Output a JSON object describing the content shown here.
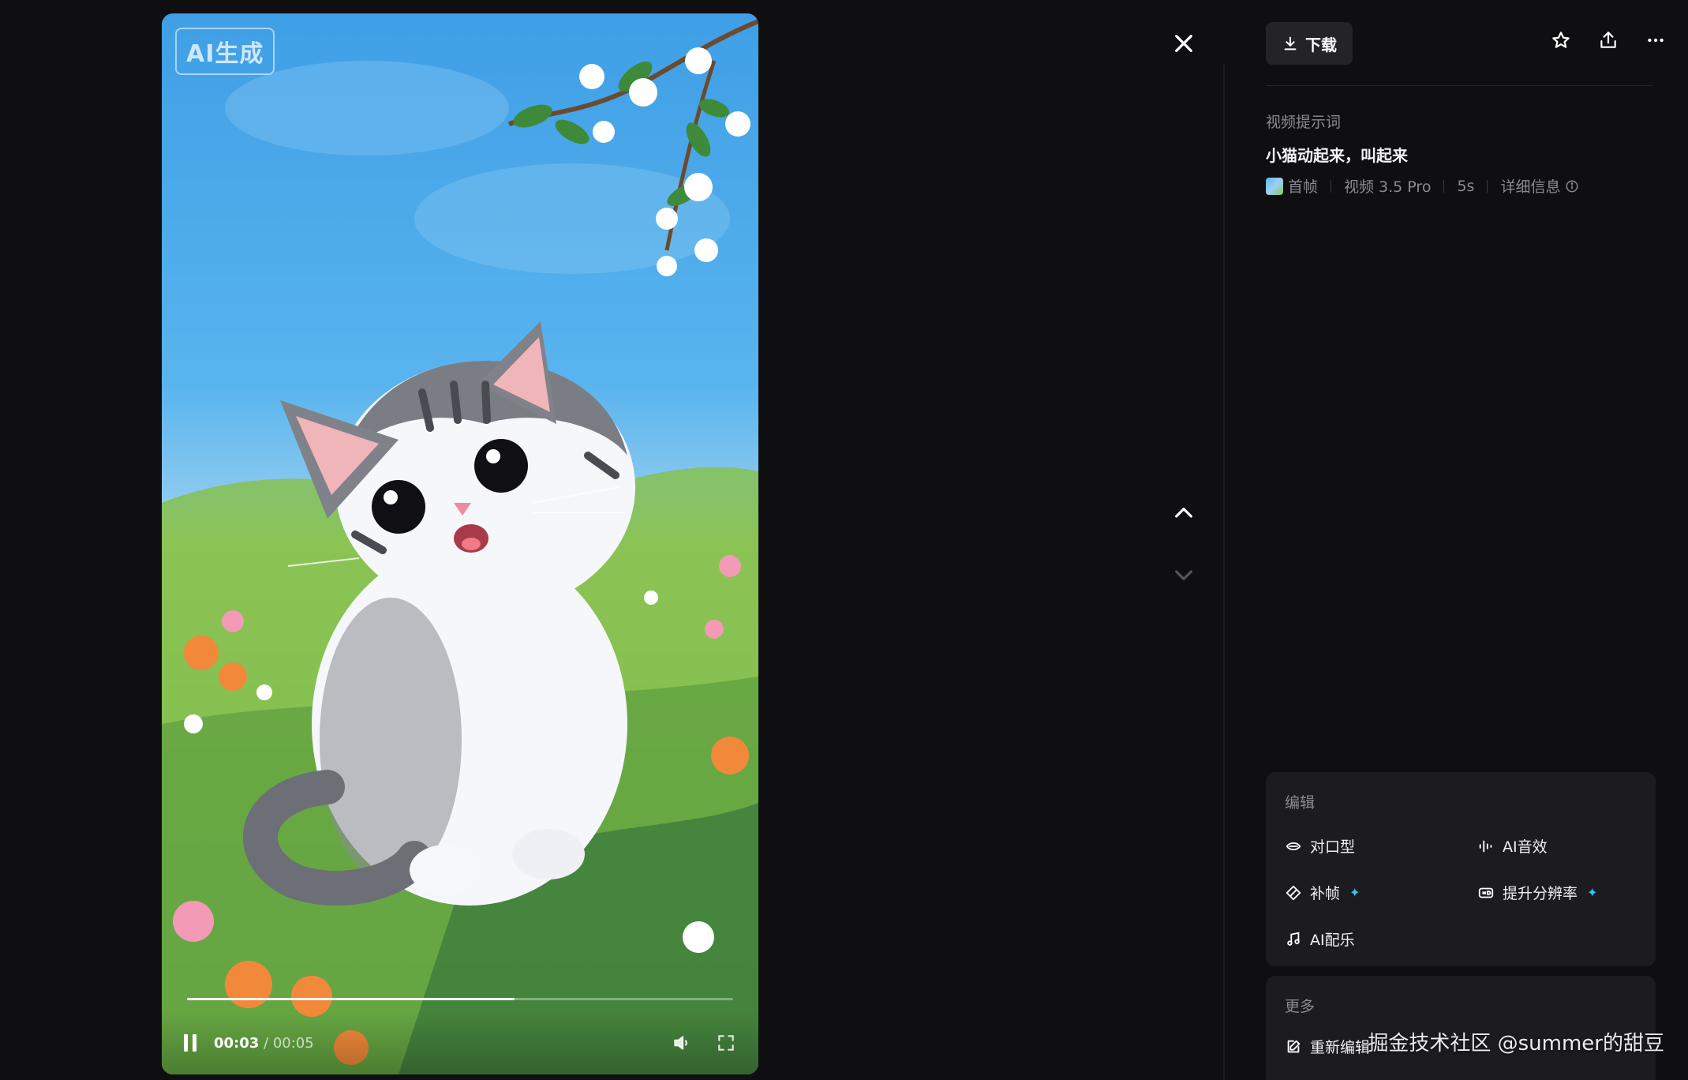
{
  "video": {
    "ai_badge": "AI生成",
    "current_time": "00:03",
    "separator": " / ",
    "total_time": "00:05",
    "progress_fraction": 0.6
  },
  "toolbar": {
    "download_label": "下载"
  },
  "prompt": {
    "label": "视频提示词",
    "text": "小猫动起来，叫起来"
  },
  "meta": {
    "first_frame": "首帧",
    "model": "视频 3.5 Pro",
    "duration": "5s",
    "details": "详细信息"
  },
  "edit": {
    "title": "编辑",
    "tools": [
      {
        "label": "对口型"
      },
      {
        "label": "AI音效"
      },
      {
        "label": "补帧"
      },
      {
        "label": "提升分辨率"
      },
      {
        "label": "AI配乐"
      }
    ]
  },
  "more": {
    "title": "更多",
    "items": [
      {
        "label": "重新编辑"
      }
    ]
  },
  "watermark": "掘金技术社区 @summer的甜豆",
  "colors": {
    "background": "#0f0f11",
    "card": "#1c1c20",
    "accent": "#2fc8f5"
  }
}
